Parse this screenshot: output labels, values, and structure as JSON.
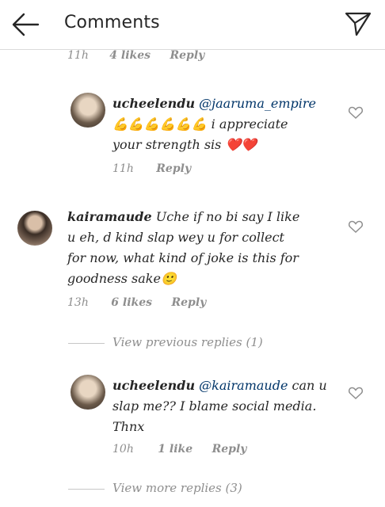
{
  "header": {
    "title": "Comments",
    "back_icon": "back-arrow-icon",
    "send_icon": "send-icon"
  },
  "top_meta": {
    "time": "11h",
    "likes": "4 likes",
    "reply": "Reply"
  },
  "reply1": {
    "username": "ucheelendu",
    "mention": "@jaaruma_empire",
    "emojis": "💪💪💪💪💪💪",
    "text_after_emoji": " i appreciate",
    "text_line2": "your strength sis ",
    "hearts": "❤️❤️",
    "time": "11h",
    "reply": "Reply"
  },
  "comment2": {
    "username": "kairamaude",
    "line1": " Uche if no bi say I like",
    "line2": "u eh, d kind slap wey u for collect",
    "line3": "for now, what kind of joke is this for",
    "line4": "goodness sake",
    "emoji": "🙂",
    "time": "13h",
    "likes": "6 likes",
    "reply": "Reply"
  },
  "view_previous": "View previous replies (1)",
  "reply2": {
    "username": "ucheelendu",
    "mention": "@kairamaude",
    "line1_rest": " can u",
    "line2": "slap me?? I blame social media.",
    "line3": "Thnx",
    "time": "10h",
    "likes": "1 like",
    "reply": "Reply"
  },
  "view_more": "View more replies (3)"
}
